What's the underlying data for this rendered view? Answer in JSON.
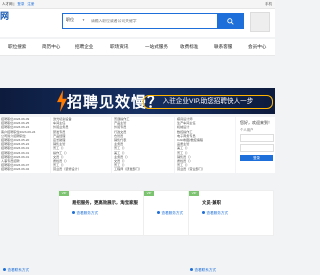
{
  "topbar": {
    "greeting": "人才网 |",
    "login": "登录",
    "register": "注册",
    "right_text": "手机"
  },
  "header": {
    "logo": "网",
    "search": {
      "category": "职位",
      "placeholder": "请输入职位或者公司关键字"
    }
  },
  "nav": {
    "items": [
      "职位搜索",
      "简历中心",
      "招聘企业",
      "职场资讯",
      "一站式服务",
      "收费标准",
      "联系客服",
      "会员中心"
    ]
  },
  "banner": {
    "headline": "招聘见效慢？",
    "pill": "入驻企业VIP,助您招聘快人一步"
  },
  "dates": [
    "招聘职位2023-06-09",
    "招聘职位2023-06-25",
    "招聘职位2023-06-24",
    "客户招聘职位2023-06-24",
    "公司简介招聘职位",
    "招聘职位2023-05-20",
    "招聘职位2023-05-22",
    "招聘职位2023-06-01",
    "招聘职位2023-06-01",
    "招聘职位2023-06-01",
    "人事专员招聘",
    "招聘职位2023-06-07",
    "招聘职位2023-06-02",
    "招聘职位2023-06-09"
  ],
  "col_a": [
    "激光切割设备",
    "车间主任",
    "外贸业务员",
    "研发专员",
    "产品经理",
    "店长助理",
    "销售主管",
    "普工（）",
    "操作工（）",
    "文员（）",
    "质检员（）",
    "普工（）",
    "营业员（装修设计）",
    "营业员（主管）"
  ],
  "col_b": [
    "普通操作工",
    "产品主管",
    "外贸专员",
    "行政文员",
    "仓管员",
    "销售代表",
    "业务员",
    "普工（）",
    "美工（）",
    "业务员（）",
    "文员（）",
    "普工（）",
    "工程师（研发部门）",
    "仓管员（生产部门）"
  ],
  "col_c": [
    "模具设计师",
    "生产车间主任",
    "机械设计",
    "数控操作工",
    "电子商务专员",
    "CAD制图/数控编程",
    "品质主管",
    "美工（）",
    "普工（）",
    "销售员（）",
    "质检员（）",
    "普工（）",
    "营业员（营业部门）",
    "普工（仓储部门）"
  ],
  "login": {
    "title": "您好，欢迎来到！",
    "subtitle": "个人用户",
    "button": "登录"
  },
  "cards": [
    {
      "tag": "VIP",
      "title": "易招服务，更高效展示，淘宝家服",
      "service": "查看服务方式"
    },
    {
      "tag": "VIP",
      "title": "",
      "service": "查看服务方式"
    },
    {
      "tag": "VIP",
      "title": "文员·兼职",
      "service": "查看服务方式"
    }
  ],
  "footer": {
    "left": "查看联系方式",
    "right": "查看联系方式"
  }
}
